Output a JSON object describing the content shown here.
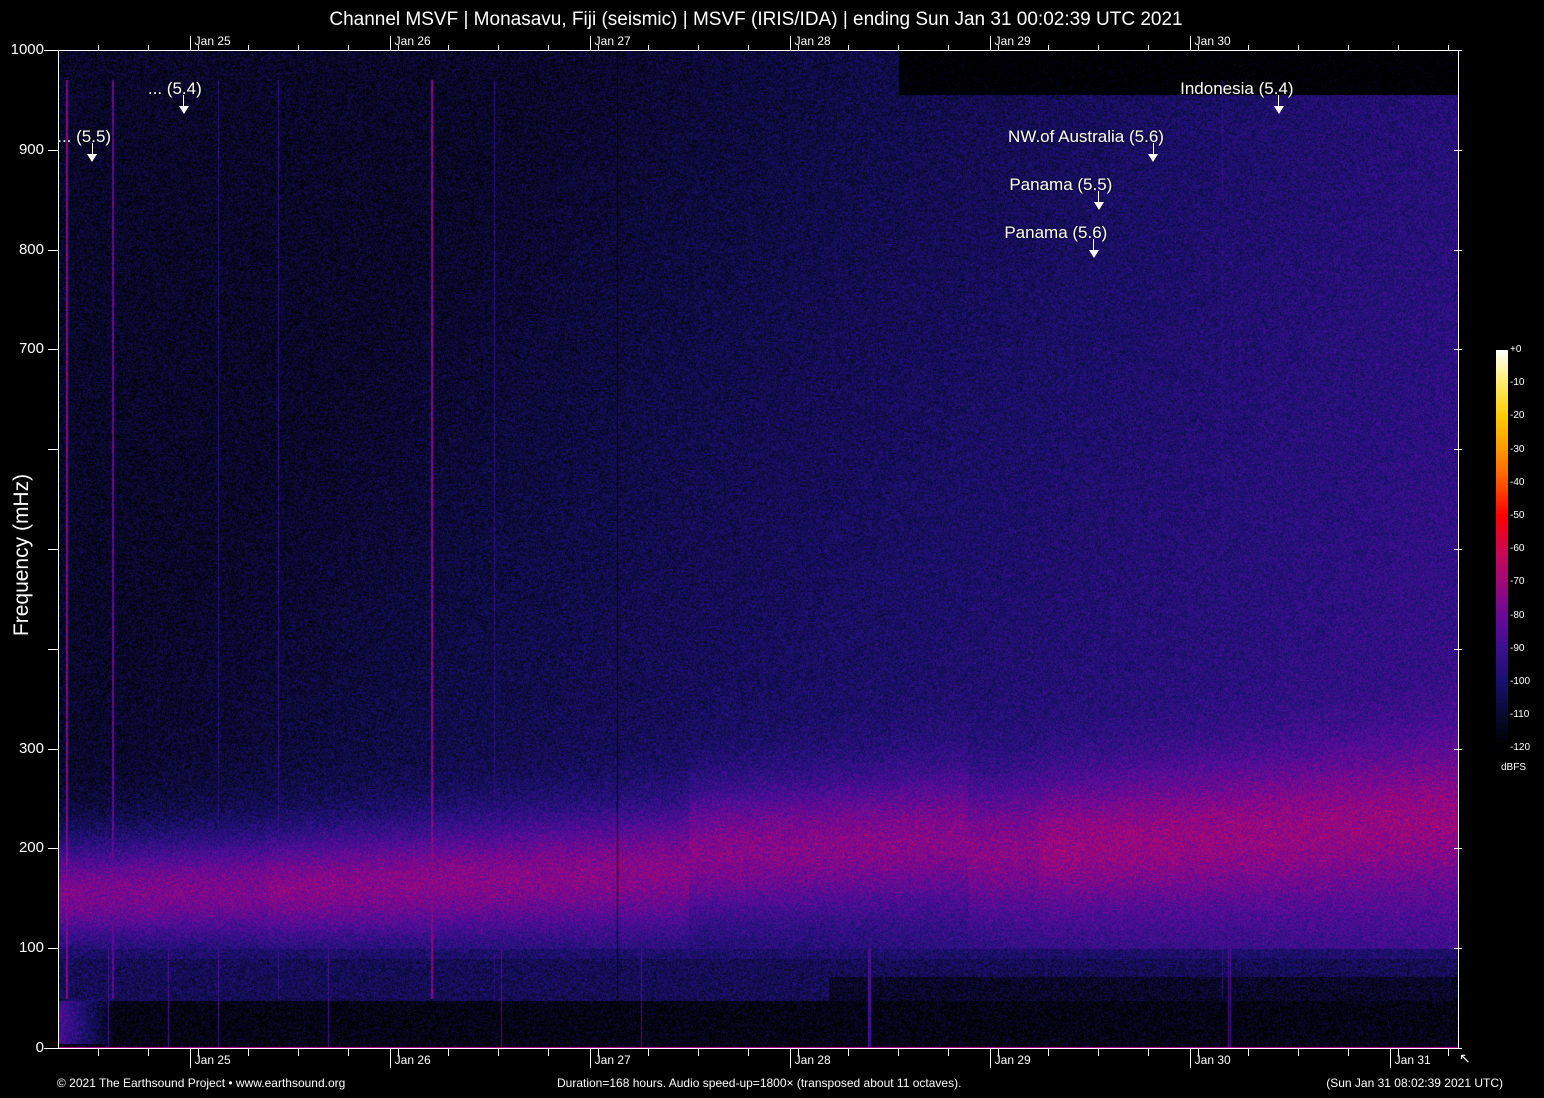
{
  "title": "Channel MSVF | Monasavu, Fiji (seismic) | MSVF (IRIS/IDA) | ending Sun Jan 31 00:02:39 UTC 2021",
  "chart_data": {
    "type": "heatmap",
    "subtype": "spectrogram",
    "title": "Channel MSVF | Monasavu, Fiji (seismic) | MSVF (IRIS/IDA) | ending Sun Jan 31 00:02:39 UTC 2021",
    "ylabel": "Frequency (mHz)",
    "ylim": [
      0,
      1000
    ],
    "y_ticks": [
      0,
      100,
      200,
      300,
      400,
      500,
      600,
      700,
      800,
      900,
      1000
    ],
    "y_tick_labels": [
      "0",
      "100",
      "200",
      "300",
      "",
      "",
      "",
      "700",
      "800",
      "900",
      "1000"
    ],
    "duration_hours": 168,
    "x_minor_tick_hours": 6,
    "x_tick_labels": [
      {
        "label": "Jan 25",
        "hour": 15.8
      },
      {
        "label": "Jan 26",
        "hour": 39.8
      },
      {
        "label": "Jan 27",
        "hour": 63.8
      },
      {
        "label": "Jan 28",
        "hour": 87.8
      },
      {
        "label": "Jan 29",
        "hour": 111.8
      },
      {
        "label": "Jan 30",
        "hour": 135.8
      },
      {
        "label": "Jan 31",
        "hour": 159.8
      }
    ],
    "colorbar": {
      "unit": "dBFS",
      "range": [
        -120,
        0
      ],
      "tick_labels": [
        "+0",
        "-10",
        "-20",
        "-30",
        "-40",
        "-50",
        "-60",
        "-70",
        "-80",
        "-90",
        "-100",
        "-110",
        "-120"
      ],
      "stops": [
        {
          "db": -120,
          "color": "#000000"
        },
        {
          "db": -110,
          "color": "#0a0a30"
        },
        {
          "db": -100,
          "color": "#1a1070"
        },
        {
          "db": -90,
          "color": "#3c1090"
        },
        {
          "db": -80,
          "color": "#6a0a98"
        },
        {
          "db": -70,
          "color": "#a0087a"
        },
        {
          "db": -60,
          "color": "#d00850"
        },
        {
          "db": -50,
          "color": "#ff0000"
        },
        {
          "db": -40,
          "color": "#ff5500"
        },
        {
          "db": -30,
          "color": "#ff9900"
        },
        {
          "db": -20,
          "color": "#ffcc00"
        },
        {
          "db": -10,
          "color": "#ffee66"
        },
        {
          "db": 0,
          "color": "#ffffff"
        }
      ]
    },
    "annotations": [
      {
        "label": "... (5.5)",
        "hour": 4.1
      },
      {
        "label": "... (5.4)",
        "hour": 15.1
      },
      {
        "label": "NW.of Australia (5.6)",
        "hour": 131.4
      },
      {
        "label": "Panama (5.5)",
        "hour": 124.9
      },
      {
        "label": "Panama (5.6)",
        "hour": 124.3
      },
      {
        "label": "Indonesia (5.4)",
        "hour": 146.5
      }
    ]
  },
  "footer": {
    "copyright": "© 2021 The Earthsound Project • www.earthsound.org",
    "info": "Duration=168 hours. Audio speed-up=1800× (transposed about 11 octaves).",
    "timestamp": "(Sun Jan 31 08:02:39 2021 UTC)"
  },
  "cursor_glyph": "↖"
}
